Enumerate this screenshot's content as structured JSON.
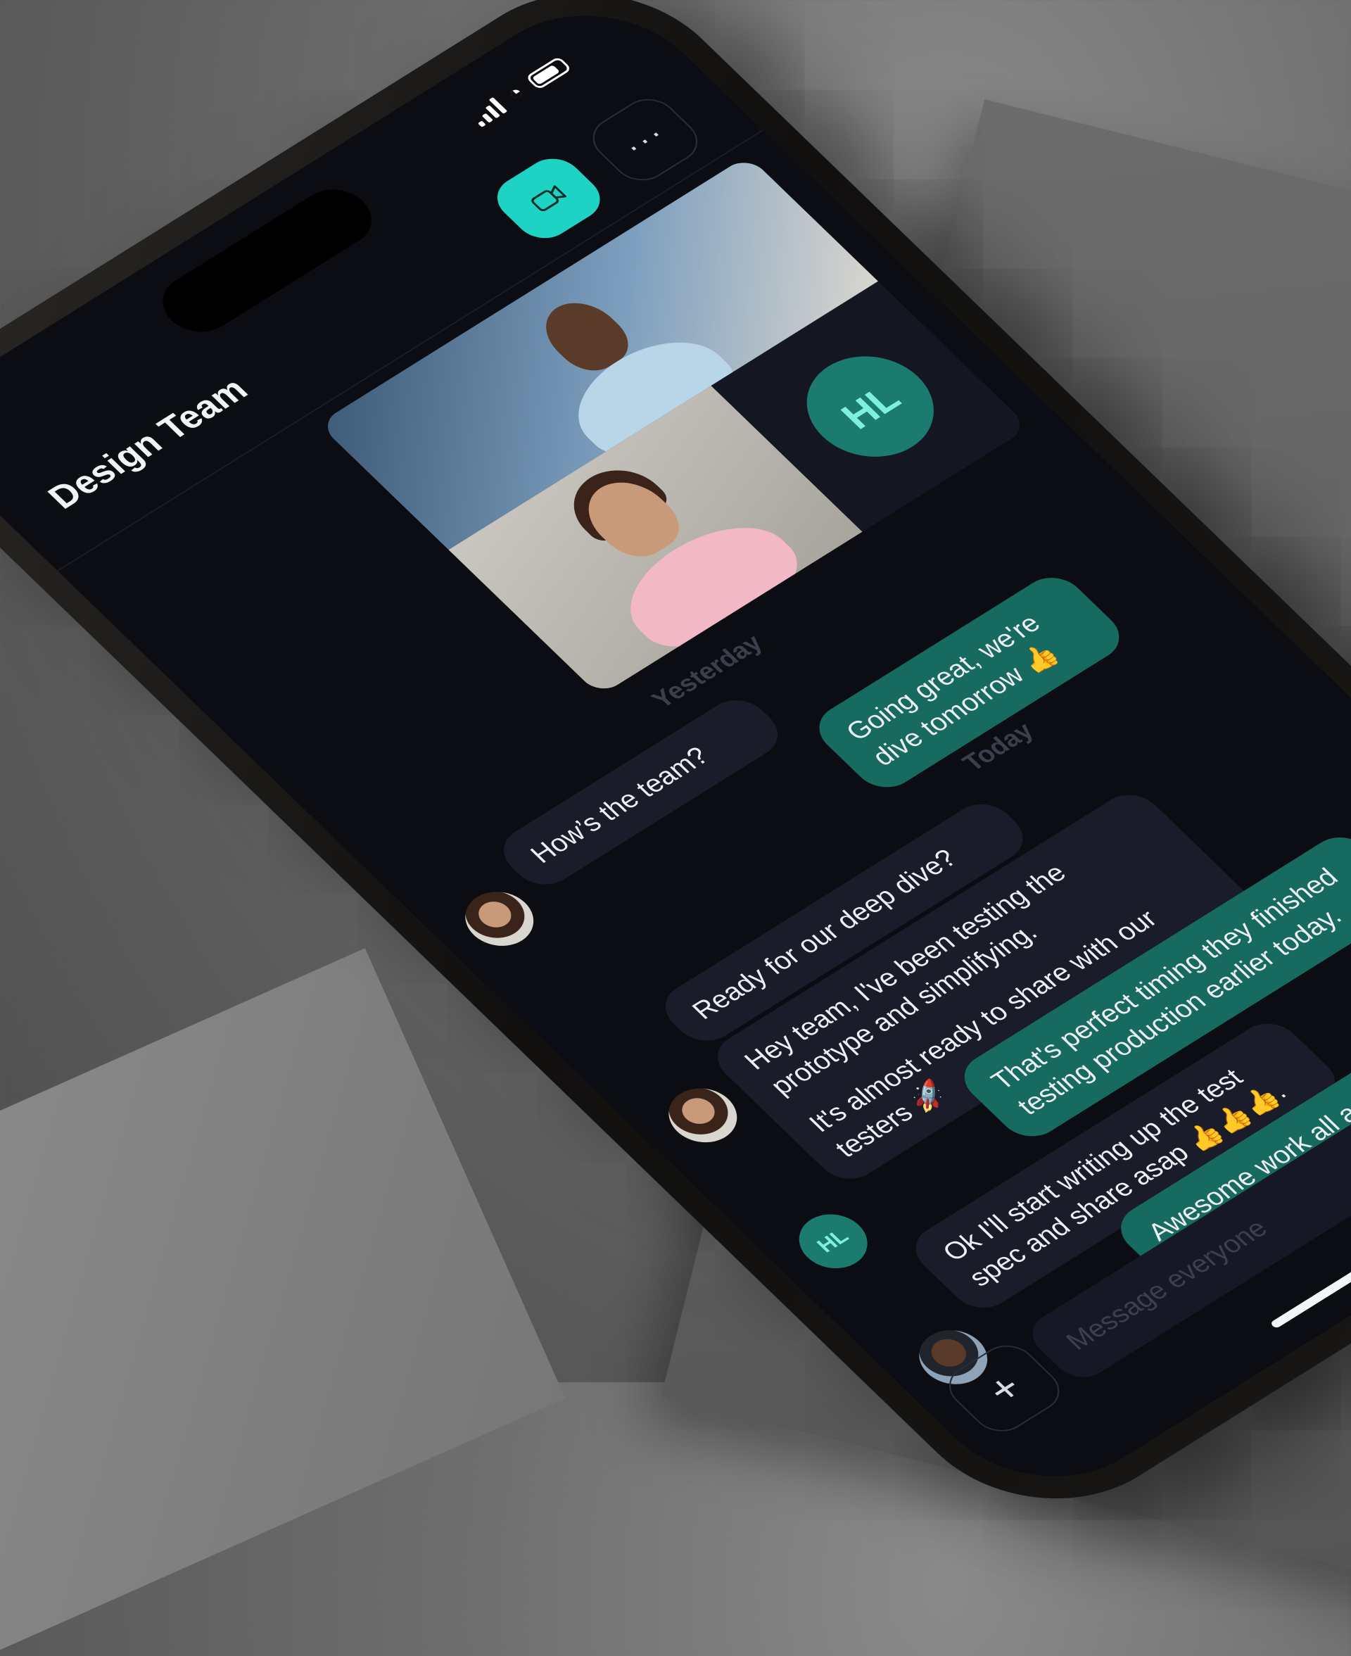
{
  "header": {
    "title": "Design Team",
    "more_label": "···"
  },
  "video": {
    "hl_initials": "HL"
  },
  "chat": {
    "day_yesterday": "Yesterday",
    "day_today": "Today",
    "messages": [
      {
        "text": "How’s the team?"
      },
      {
        "text": "Going great, we're dive tomorrow 👍"
      },
      {
        "text": "Ready for our deep dive?"
      },
      {
        "text": "Hey team, I've been testing the prototype and simplifying."
      },
      {
        "text": "It's almost ready to share with our testers 🚀"
      },
      {
        "text": "That's perfect timing they finished testing production earlier today."
      },
      {
        "text": "Ok I'll start writing up the test spec and share asap 👍👍👍."
      },
      {
        "text": "Awesome work all around, looking forward to the results 🔥."
      }
    ],
    "hl_initials": "HL"
  },
  "composer": {
    "placeholder": "Message everyone",
    "plus_label": "+"
  },
  "colors": {
    "accent": "#1fd3c4",
    "bubble_out": "#176a5f",
    "bubble_in": "#1a1d29",
    "screen_bg": "#0b0d12"
  },
  "icons": [
    "signal-icon",
    "wifi-icon",
    "battery-icon",
    "video-camera-icon",
    "more-icon",
    "plus-icon"
  ]
}
